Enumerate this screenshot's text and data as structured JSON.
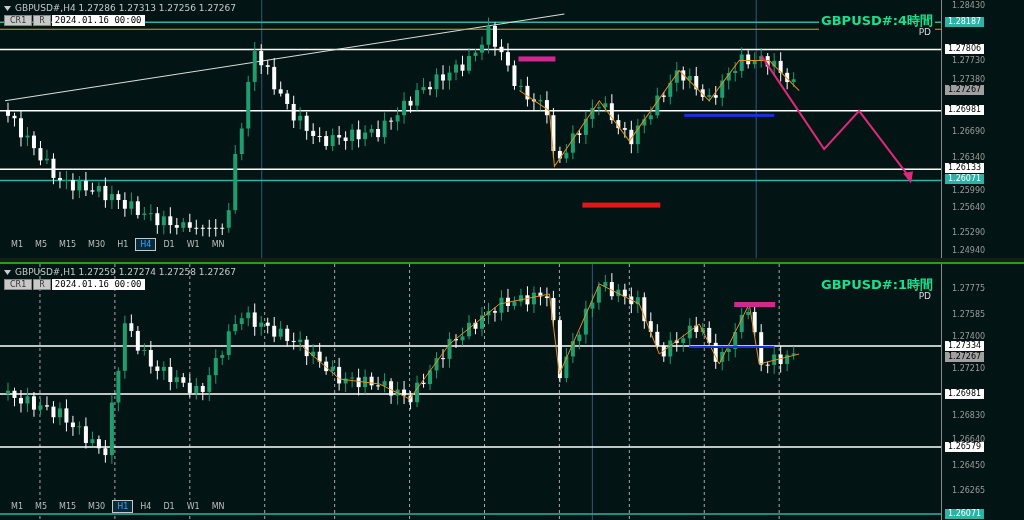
{
  "panels": [
    {
      "info": "GBPUSD#,H4  1.27286 1.27313 1.27256 1.27267",
      "buttons": [
        "CR1",
        "R"
      ],
      "date": "2024.01.16 00:00",
      "title": "GBPUSD#:4時間",
      "subtitle": "PD",
      "ticks": [
        "1.28430",
        "1.27730",
        "1.27380",
        "1.26690",
        "1.26340",
        "1.25990",
        "1.25640",
        "1.25290",
        "1.24940"
      ],
      "levels": [
        {
          "price": "1.28187",
          "kind": "line",
          "color": "#2ab3a6"
        },
        {
          "price": "1.27806",
          "kind": "line",
          "color": "#ffffff"
        },
        {
          "price": "1.27267",
          "kind": "bid",
          "color": "#a0a0a0"
        },
        {
          "price": "1.26981",
          "kind": "line",
          "color": "#ffffff"
        },
        {
          "price": "1.26133",
          "kind": "line",
          "color": "#ffffff"
        },
        {
          "price": "1.26071",
          "kind": "line",
          "color": "#2ab3a6"
        }
      ],
      "timeframes": [
        {
          "label": "M1",
          "selected": false
        },
        {
          "label": "M5",
          "selected": false
        },
        {
          "label": "M15",
          "selected": false
        },
        {
          "label": "M30",
          "selected": false
        },
        {
          "label": "H1",
          "selected": false
        },
        {
          "label": "H4",
          "selected": true
        },
        {
          "label": "D1",
          "selected": false
        },
        {
          "label": "W1",
          "selected": false
        },
        {
          "label": "MN",
          "selected": false
        }
      ]
    },
    {
      "info": "GBPUSD#,H1  1.27259 1.27274 1.27258 1.27267",
      "buttons": [
        "CR1",
        "R"
      ],
      "date": "2024.01.16 00:00",
      "title": "GBPUSD#:1時間",
      "subtitle": "PD",
      "ticks": [
        "1.27775",
        "1.27585",
        "1.27400",
        "1.27210",
        "1.26830",
        "1.26640",
        "1.26450",
        "1.26265"
      ],
      "levels": [
        {
          "price": "1.27334",
          "kind": "line",
          "color": "#ffffff"
        },
        {
          "price": "1.27267",
          "kind": "bid",
          "color": "#a0a0a0"
        },
        {
          "price": "1.26981",
          "kind": "line",
          "color": "#ffffff"
        },
        {
          "price": "1.26579",
          "kind": "line",
          "color": "#ffffff"
        },
        {
          "price": "1.26071",
          "kind": "line",
          "color": "#2ab3a6"
        }
      ],
      "timeframes": [
        {
          "label": "M1",
          "selected": false
        },
        {
          "label": "M5",
          "selected": false
        },
        {
          "label": "M15",
          "selected": false
        },
        {
          "label": "M30",
          "selected": false
        },
        {
          "label": "H1",
          "selected": true
        },
        {
          "label": "H4",
          "selected": false
        },
        {
          "label": "D1",
          "selected": false
        },
        {
          "label": "W1",
          "selected": false
        },
        {
          "label": "MN",
          "selected": false
        }
      ]
    }
  ]
}
